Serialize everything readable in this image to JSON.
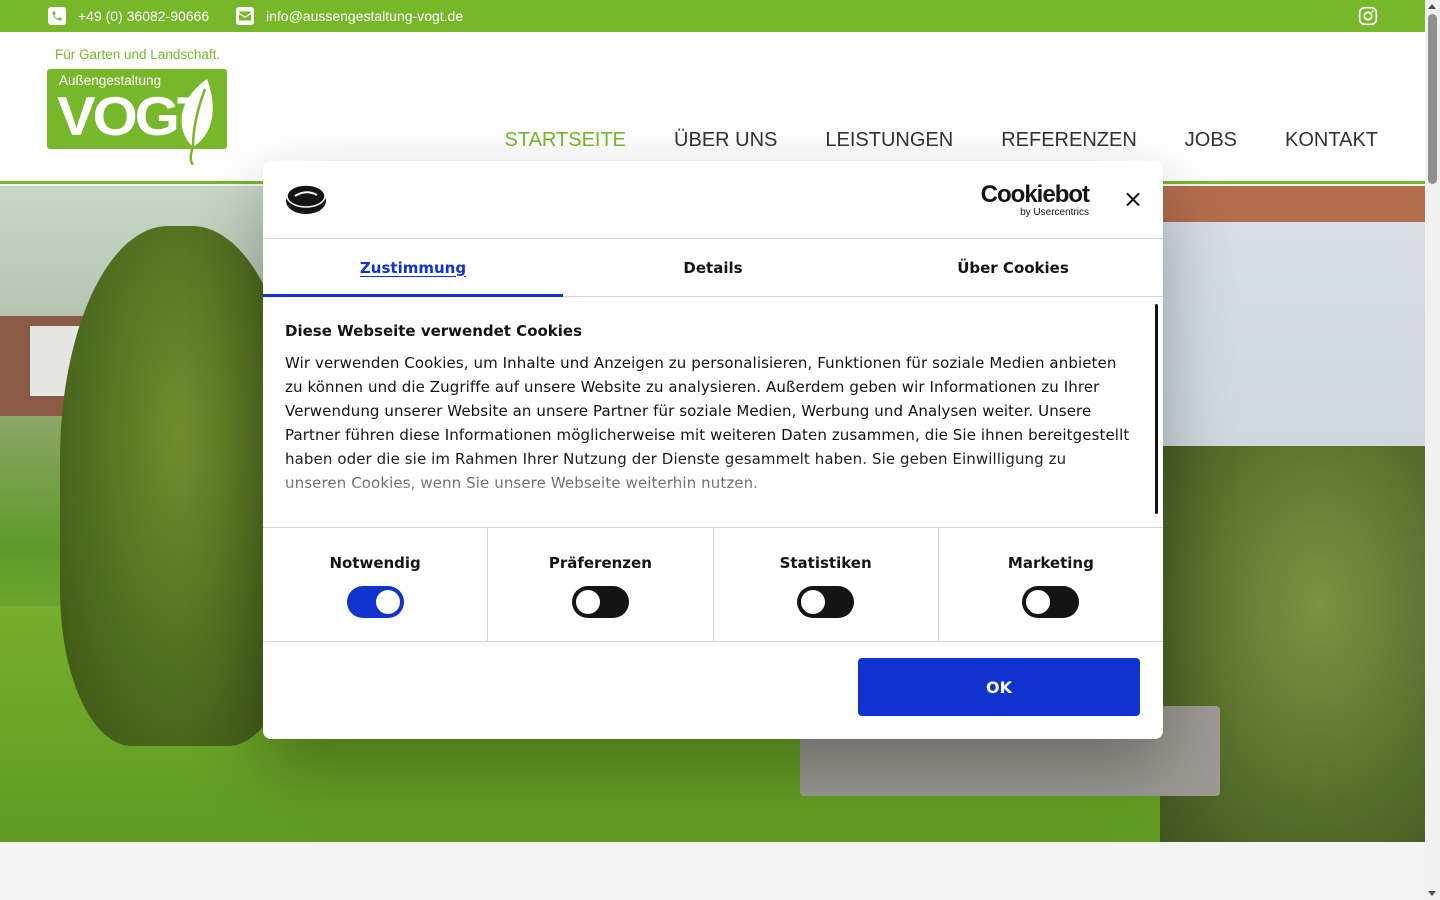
{
  "topbar": {
    "phone": "+49 (0) 36082-90666",
    "email": "info@aussengestaltung-vogt.de",
    "phone_icon": "phone-icon",
    "email_icon": "envelope-icon",
    "social_icon": "instagram-icon"
  },
  "header": {
    "tagline": "Für Garten und Landschaft.",
    "logo_sub": "Außengestaltung",
    "logo_main": "VOGT",
    "brand_color": "#76b82a"
  },
  "nav": {
    "items": [
      {
        "label": "STARTSEITE",
        "active": true
      },
      {
        "label": "ÜBER UNS",
        "active": false
      },
      {
        "label": "LEISTUNGEN",
        "active": false
      },
      {
        "label": "REFERENZEN",
        "active": false
      },
      {
        "label": "JOBS",
        "active": false
      },
      {
        "label": "KONTAKT",
        "active": false
      }
    ]
  },
  "cookie_dialog": {
    "brand_main": "Cookiebot",
    "brand_sub": "by Usercentrics",
    "close_label": "×",
    "tabs": [
      {
        "label": "Zustimmung",
        "active": true
      },
      {
        "label": "Details",
        "active": false
      },
      {
        "label": "Über Cookies",
        "active": false
      }
    ],
    "heading": "Diese Webseite verwendet Cookies",
    "body": "Wir verwenden Cookies, um Inhalte und Anzeigen zu personalisieren, Funktionen für soziale Medien anbieten zu können und die Zugriffe auf unsere Website zu analysieren. Außerdem geben wir Informationen zu Ihrer Verwendung unserer Website an unsere Partner für soziale Medien, Werbung und Analysen weiter. Unsere Partner führen diese Informationen möglicherweise mit weiteren Daten zusammen, die Sie ihnen bereitgestellt haben oder die sie im Rahmen Ihrer Nutzung der Dienste gesammelt haben. Sie geben Einwilligung zu unseren Cookies, wenn Sie unsere Webseite weiterhin nutzen.",
    "toggles": [
      {
        "label": "Notwendig",
        "on": true
      },
      {
        "label": "Präferenzen",
        "on": false
      },
      {
        "label": "Statistiken",
        "on": false
      },
      {
        "label": "Marketing",
        "on": false
      }
    ],
    "ok_label": "OK",
    "accent_color": "#1032cf"
  }
}
